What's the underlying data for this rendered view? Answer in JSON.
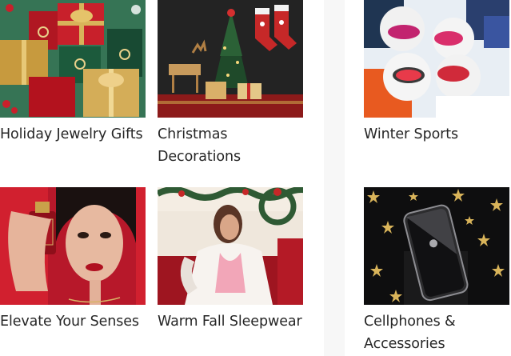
{
  "categories": [
    {
      "label": "Holiday Jewelry Gifts",
      "image": "holiday-jewelry-gift-boxes-image"
    },
    {
      "label": "Christmas Decorations",
      "image": "christmas-tree-stockings-reindeer-image"
    },
    {
      "label": "Winter Sports",
      "image": "skiers-in-goggles-snow-image"
    },
    {
      "label": "Elevate Your Senses",
      "image": "woman-with-perfume-bottle-image"
    },
    {
      "label": "Warm Fall Sleepwear",
      "image": "woman-in-plush-robe-image"
    },
    {
      "label": "Cellphones & Accessories",
      "image": "smartphone-with-gold-stars-image"
    }
  ]
}
